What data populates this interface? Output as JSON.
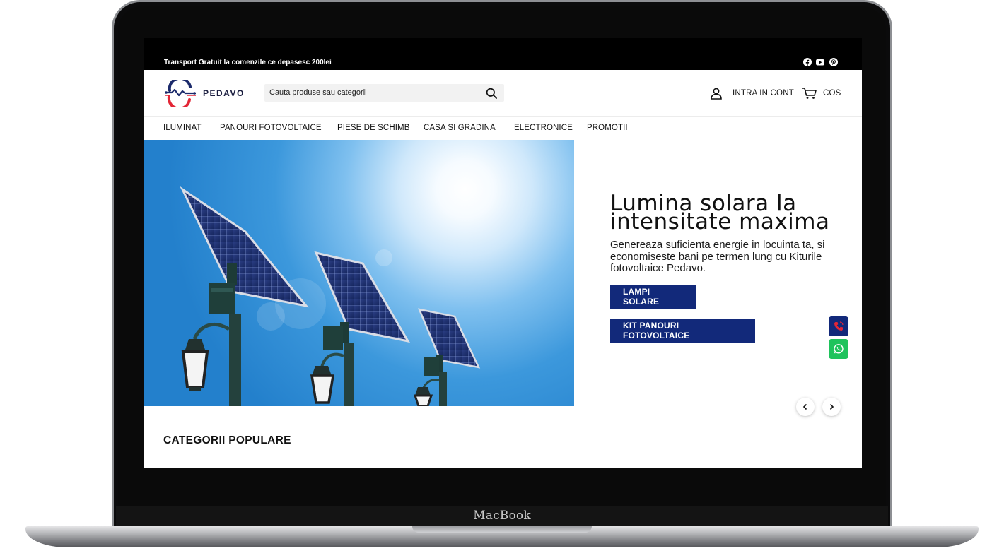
{
  "device": {
    "brand_label": "MacBook"
  },
  "announcement": {
    "text": "Transport Gratuit la comenzile ce depasesc 200lei",
    "social_icons": [
      "facebook-icon",
      "youtube-icon",
      "pinterest-icon"
    ]
  },
  "header": {
    "logo_text": "PEDAVO",
    "search_placeholder": "Cauta produse sau categorii",
    "account_label": "INTRA IN CONT",
    "cart_label": "COS"
  },
  "nav": {
    "items": [
      {
        "label": "ILUMINAT"
      },
      {
        "label": "PANOURI FOTOVOLTAICE"
      },
      {
        "label": "PIESE DE SCHIMB"
      },
      {
        "label": "CASA SI GRADINA"
      },
      {
        "label": "ELECTRONICE"
      },
      {
        "label": "PROMOTII"
      }
    ]
  },
  "hero": {
    "title_line1": "Lumina solara la",
    "title_line2": "intensitate maxima",
    "subtitle": "Genereaza suficienta energie in locuinta ta, si economiseste bani pe termen lung cu Kiturile fotovoltaice Pedavo.",
    "button1": "LAMPI SOLARE",
    "button2": "KIT PANOURI FOTOVOLTAICE"
  },
  "sections": {
    "popular_title": "CATEGORII POPULARE"
  },
  "colors": {
    "primary": "#12297a",
    "whatsapp": "#1fc35c",
    "announcement_bg": "#000000",
    "phone_icon": "#e32636"
  }
}
